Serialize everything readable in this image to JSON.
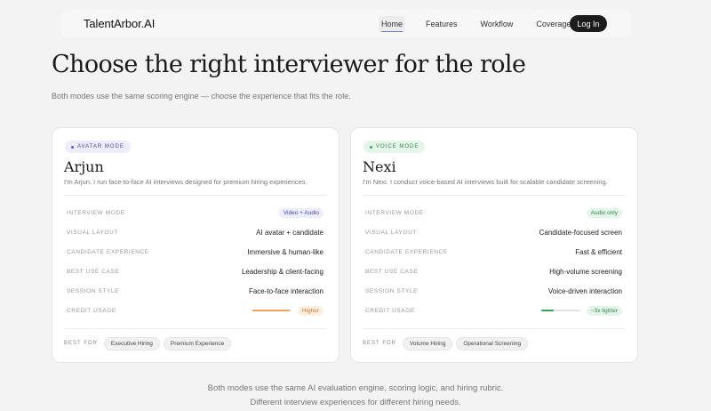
{
  "nav": {
    "brand": "TalentArbor.AI",
    "links": [
      "Home",
      "Features",
      "Workflow",
      "Coverage"
    ],
    "login": "Log In"
  },
  "hero": {
    "title": "Choose the right interviewer for the role",
    "subtitle": "Both modes use the same scoring engine — choose the experience that fits the role."
  },
  "cards": [
    {
      "mode": "AVATAR MODE",
      "name": "Arjun",
      "description": "I'm Arjun. I run face-to-face AI interviews designed for premium hiring experiences.",
      "rows": [
        {
          "label": "INTERVIEW MODE",
          "value": "Video + Audio"
        },
        {
          "label": "VISUAL LAYOUT",
          "value": "AI avatar + candidate"
        },
        {
          "label": "CANDIDATE EXPERIENCE",
          "value": "Immersive & human-like"
        },
        {
          "label": "BEST USE CASE",
          "value": "Leadership & client-facing"
        },
        {
          "label": "SESSION STYLE",
          "value": "Face-to-face interaction"
        },
        {
          "label": "CREDIT USAGE",
          "value": "Higher",
          "level": 0.95
        }
      ],
      "best_for_label": "BEST FOR",
      "tags": [
        "Executive Hiring",
        "Premium Experience"
      ],
      "accent": "#5a5ad0"
    },
    {
      "mode": "VOICE MODE",
      "name": "Nexi",
      "description": "I'm Nexi. I conduct voice-based AI interviews built for scalable candidate screening.",
      "rows": [
        {
          "label": "INTERVIEW MODE",
          "value": "Audio only"
        },
        {
          "label": "VISUAL LAYOUT",
          "value": "Candidate-focused screen"
        },
        {
          "label": "CANDIDATE EXPERIENCE",
          "value": "Fast & efficient"
        },
        {
          "label": "BEST USE CASE",
          "value": "High-volume screening"
        },
        {
          "label": "SESSION STYLE",
          "value": "Voice-driven interaction"
        },
        {
          "label": "CREDIT USAGE",
          "value": "~3x lighter",
          "level": 0.33
        }
      ],
      "best_for_label": "BEST FOR",
      "tags": [
        "Volume Hiring",
        "Operational Screening"
      ],
      "accent": "#35a55a"
    }
  ],
  "footer": {
    "line1": "Both modes use the same AI evaluation engine, scoring logic, and hiring rubric.",
    "line2": "Different interview experiences for different hiring needs."
  }
}
